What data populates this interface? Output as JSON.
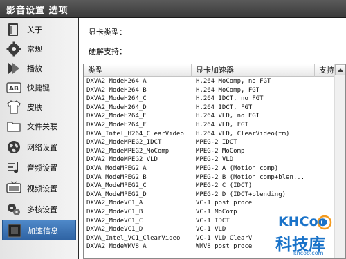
{
  "window": {
    "title": "影音设置  选项"
  },
  "sidebar": {
    "items": [
      {
        "label": "关于",
        "icon": "book-icon",
        "active": false
      },
      {
        "label": "常规",
        "icon": "gear-icon",
        "active": false
      },
      {
        "label": "播放",
        "icon": "play-icon",
        "active": false
      },
      {
        "label": "快捷键",
        "icon": "keyboard-icon",
        "active": false
      },
      {
        "label": "皮肤",
        "icon": "shirt-icon",
        "active": false
      },
      {
        "label": "文件关联",
        "icon": "folder-icon",
        "active": false
      },
      {
        "label": "网络设置",
        "icon": "globe-icon",
        "active": false
      },
      {
        "label": "音频设置",
        "icon": "audio-icon",
        "active": false
      },
      {
        "label": "视频设置",
        "icon": "tv-icon",
        "active": false
      },
      {
        "label": "多核设置",
        "icon": "multicore-gear-icon",
        "active": false
      },
      {
        "label": "加速信息",
        "icon": "chip-icon",
        "active": true
      }
    ]
  },
  "main": {
    "gpu_type_label": "显卡类型：",
    "hw_decode_label": "硬解支持："
  },
  "list": {
    "columns": [
      "类型",
      "显卡加速器",
      "支持"
    ],
    "rows": [
      [
        "DXVA2_ModeH264_A",
        "H.264 MoComp, no FGT",
        ""
      ],
      [
        "DXVA2_ModeH264_B",
        "H.264 MoComp, FGT",
        ""
      ],
      [
        "DXVA2_ModeH264_C",
        "H.264 IDCT, no FGT",
        ""
      ],
      [
        "DXVA2_ModeH264_D",
        "H.264 IDCT, FGT",
        ""
      ],
      [
        "DXVA2_ModeH264_E",
        "H.264 VLD, no FGT",
        ""
      ],
      [
        "DXVA2_ModeH264_F",
        "H.264 VLD, FGT",
        ""
      ],
      [
        "DXVA_Intel_H264_ClearVideo",
        "H.264 VLD, ClearVideo(tm)",
        ""
      ],
      [
        "DXVA2_ModeMPEG2_IDCT",
        "MPEG-2 IDCT",
        ""
      ],
      [
        "DXVA2_ModeMPEG2_MoComp",
        "MPEG-2 MoComp",
        ""
      ],
      [
        "DXVA2_ModeMPEG2_VLD",
        "MPEG-2 VLD",
        ""
      ],
      [
        "DXVA_ModeMPEG2_A",
        "MPEG-2 A (Motion comp)",
        ""
      ],
      [
        "DXVA_ModeMPEG2_B",
        "MPEG-2 B (Motion comp+blen...",
        ""
      ],
      [
        "DXVA_ModeMPEG2_C",
        "MPEG-2 C (IDCT)",
        ""
      ],
      [
        "DXVA_ModeMPEG2_D",
        "MPEG-2 D (IDCT+blending)",
        ""
      ],
      [
        "DXVA2_ModeVC1_A",
        "VC-1 post proce",
        ""
      ],
      [
        "DXVA2_ModeVC1_B",
        "VC-1 MoComp",
        ""
      ],
      [
        "DXVA2_ModeVC1_C",
        "VC-1 IDCT",
        ""
      ],
      [
        "DXVA2_ModeVC1_D",
        "VC-1 VLD",
        ""
      ],
      [
        "DXVA_Intel_VC1_ClearVideo",
        "VC-1 VLD ClearV",
        ""
      ],
      [
        "DXVA2_ModeWMV8_A",
        "WMV8 post proce",
        ""
      ]
    ]
  },
  "watermark": {
    "brand": "KHCoo",
    "site_cn": "科技库",
    "domain": "khcoo.com"
  },
  "colors": {
    "accent": "#3a72b8",
    "titlebar": "#444444",
    "brand_blue": "#1a73c9",
    "brand_orange": "#f39a1e"
  }
}
